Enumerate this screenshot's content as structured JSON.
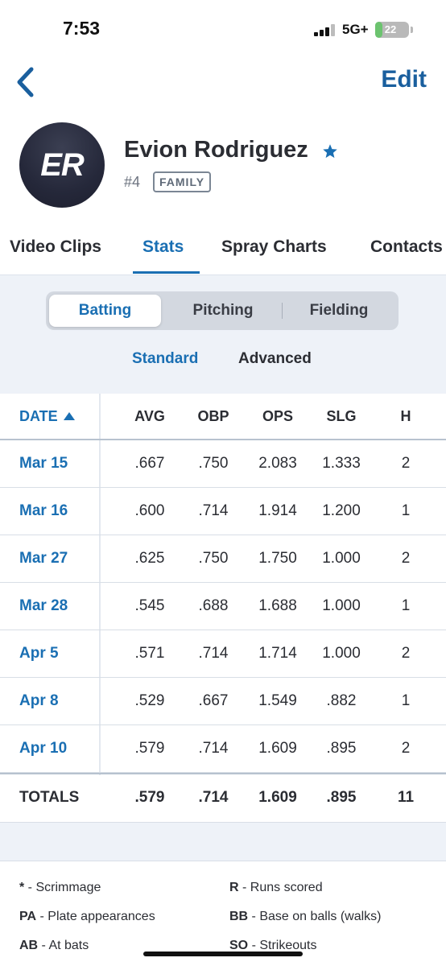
{
  "status": {
    "time": "7:53",
    "network": "5G+",
    "battery": "22",
    "battery_level": 0.22
  },
  "nav": {
    "edit_label": "Edit"
  },
  "profile": {
    "initials": "ER",
    "name": "Evion Rodriguez",
    "number": "#4",
    "badge": "FAMILY"
  },
  "tabs": [
    {
      "label": "Video Clips"
    },
    {
      "label": "Stats"
    },
    {
      "label": "Spray Charts"
    },
    {
      "label": "Contacts"
    }
  ],
  "segments": [
    {
      "label": "Batting"
    },
    {
      "label": "Pitching"
    },
    {
      "label": "Fielding"
    }
  ],
  "subtabs": [
    {
      "label": "Standard"
    },
    {
      "label": "Advanced"
    }
  ],
  "table": {
    "headers": {
      "date": "DATE",
      "avg": "AVG",
      "obp": "OBP",
      "ops": "OPS",
      "slg": "SLG",
      "h": "H"
    },
    "rows": [
      {
        "date": "Mar 15",
        "avg": ".667",
        "obp": ".750",
        "ops": "2.083",
        "slg": "1.333",
        "h": "2"
      },
      {
        "date": "Mar 16",
        "avg": ".600",
        "obp": ".714",
        "ops": "1.914",
        "slg": "1.200",
        "h": "1"
      },
      {
        "date": "Mar 27",
        "avg": ".625",
        "obp": ".750",
        "ops": "1.750",
        "slg": "1.000",
        "h": "2"
      },
      {
        "date": "Mar 28",
        "avg": ".545",
        "obp": ".688",
        "ops": "1.688",
        "slg": "1.000",
        "h": "1"
      },
      {
        "date": "Apr 5",
        "avg": ".571",
        "obp": ".714",
        "ops": "1.714",
        "slg": "1.000",
        "h": "2"
      },
      {
        "date": "Apr 8",
        "avg": ".529",
        "obp": ".667",
        "ops": "1.549",
        "slg": ".882",
        "h": "1"
      },
      {
        "date": "Apr 10",
        "avg": ".579",
        "obp": ".714",
        "ops": "1.609",
        "slg": ".895",
        "h": "2"
      }
    ],
    "totals": {
      "date": "TOTALS",
      "avg": ".579",
      "obp": ".714",
      "ops": "1.609",
      "slg": ".895",
      "h": "11"
    }
  },
  "legend": [
    {
      "abbr": "*",
      "desc": " - Scrimmage"
    },
    {
      "abbr": "R",
      "desc": " - Runs scored"
    },
    {
      "abbr": "PA",
      "desc": " - Plate appearances"
    },
    {
      "abbr": "BB",
      "desc": " - Base on balls (walks)"
    },
    {
      "abbr": "AB",
      "desc": " - At bats"
    },
    {
      "abbr": "SO",
      "desc": " - Strikeouts"
    }
  ],
  "colors": {
    "accent": "#1a6fb3",
    "edit": "#1a5f9e",
    "text": "#2b2d33",
    "muted": "#6d7480",
    "panel": "#eef2f8"
  },
  "icons": {
    "back": "chevron-left-icon",
    "favorite": "star-icon",
    "sort": "sort-ascending-icon"
  }
}
